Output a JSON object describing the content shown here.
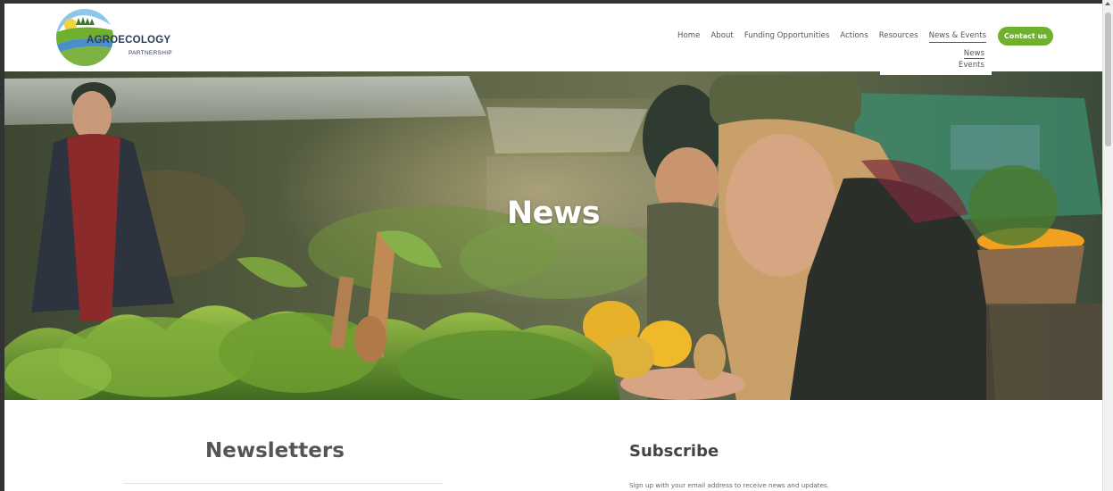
{
  "brand": {
    "name": "AGROECOLOGY",
    "subtitle": "PARTNERSHIP"
  },
  "nav": {
    "items": [
      {
        "label": "Home"
      },
      {
        "label": "About"
      },
      {
        "label": "Funding Opportunities"
      },
      {
        "label": "Actions"
      },
      {
        "label": "Resources"
      },
      {
        "label": "News & Events"
      }
    ],
    "contact_label": "Contact us",
    "dropdown": [
      "News",
      "Events"
    ]
  },
  "hero": {
    "title": "News"
  },
  "main": {
    "newsletters_heading": "Newsletters",
    "subscribe_heading": "Subscribe",
    "subscribe_text": "Sign up with your email address to receive news and updates."
  },
  "colors": {
    "accent": "#6fb02c",
    "brand_text": "#2d3c5a"
  }
}
